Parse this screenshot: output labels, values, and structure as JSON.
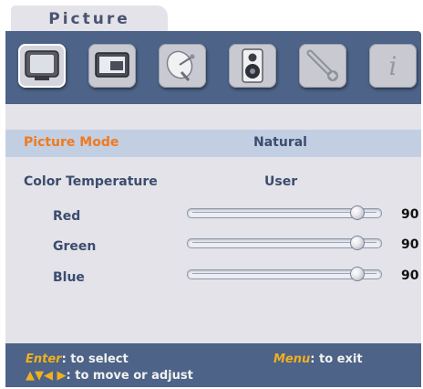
{
  "menu": {
    "title": "Picture",
    "tabs": [
      {
        "icon": "tv-icon",
        "active": true
      },
      {
        "icon": "screen-icon",
        "active": false
      },
      {
        "icon": "satellite-dish-icon",
        "active": false
      },
      {
        "icon": "speaker-icon",
        "active": false
      },
      {
        "icon": "wrench-icon",
        "active": false
      },
      {
        "icon": "info-icon",
        "label": "i",
        "active": false
      }
    ]
  },
  "settings": {
    "picture_mode": {
      "label": "Picture Mode",
      "value": "Natural"
    },
    "color_temperature": {
      "label": "Color Temperature",
      "value": "User"
    },
    "sliders": [
      {
        "label": "Red",
        "value": "90",
        "level": 0.9
      },
      {
        "label": "Green",
        "value": "90",
        "level": 0.9
      },
      {
        "label": "Blue",
        "value": "90",
        "level": 0.9
      }
    ]
  },
  "footer": {
    "enter_key": "Enter",
    "enter_text": ":  to select",
    "menu_key": "Menu",
    "menu_text": ":  to exit",
    "arrows": "▲▼◀ ▶",
    "arrows_text": ":  to move or adjust"
  },
  "colors": {
    "panel_blue": "#4d6387",
    "highlight_row": "#c2cfe3",
    "highlight_text": "#f07a1c",
    "footer_key": "#f0b020"
  }
}
